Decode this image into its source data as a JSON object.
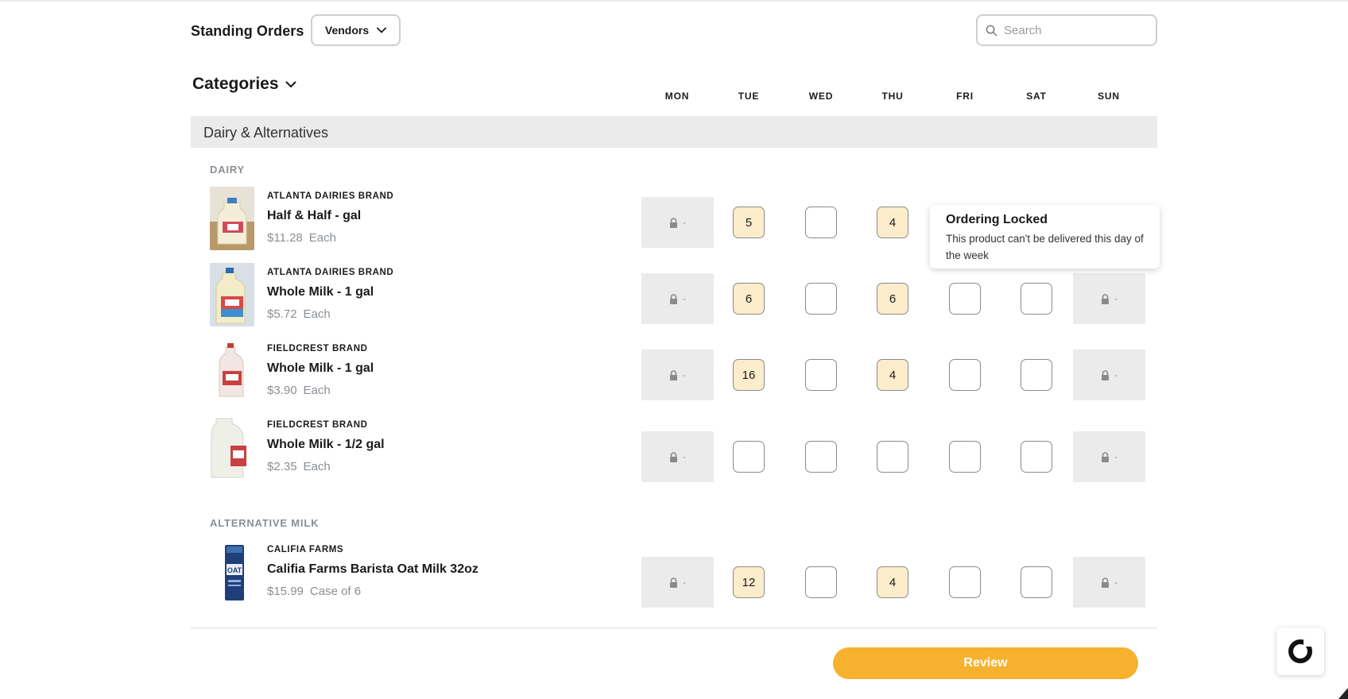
{
  "header": {
    "title": "Standing Orders",
    "vendors_label": "Vendors",
    "search_placeholder": "Search"
  },
  "categories_label": "Categories",
  "days": [
    "MON",
    "TUE",
    "WED",
    "THU",
    "FRI",
    "SAT",
    "SUN"
  ],
  "group_title": "Dairy & Alternatives",
  "sections": {
    "dairy": "DAIRY",
    "alt": "ALTERNATIVE MILK"
  },
  "products": [
    {
      "brand": "ATLANTA DAIRIES BRAND",
      "name": "Half & Half - gal",
      "price": "$11.28",
      "unit": "Each",
      "days": [
        {
          "locked": true,
          "value": "-"
        },
        {
          "locked": false,
          "value": "5"
        },
        {
          "locked": false,
          "value": ""
        },
        {
          "locked": false,
          "value": "4"
        },
        {
          "hidden": true
        },
        {
          "hidden": true
        },
        {
          "hidden": true
        }
      ]
    },
    {
      "brand": "ATLANTA DAIRIES BRAND",
      "name": "Whole Milk - 1 gal",
      "price": "$5.72",
      "unit": "Each",
      "days": [
        {
          "locked": true,
          "value": "-"
        },
        {
          "locked": false,
          "value": "6"
        },
        {
          "locked": false,
          "value": ""
        },
        {
          "locked": false,
          "value": "6"
        },
        {
          "locked": false,
          "value": ""
        },
        {
          "locked": false,
          "value": ""
        },
        {
          "locked": true,
          "value": "-"
        }
      ]
    },
    {
      "brand": "FIELDCREST BRAND",
      "name": "Whole Milk - 1 gal",
      "price": "$3.90",
      "unit": "Each",
      "days": [
        {
          "locked": true,
          "value": "-"
        },
        {
          "locked": false,
          "value": "16"
        },
        {
          "locked": false,
          "value": ""
        },
        {
          "locked": false,
          "value": "4"
        },
        {
          "locked": false,
          "value": ""
        },
        {
          "locked": false,
          "value": ""
        },
        {
          "locked": true,
          "value": "-"
        }
      ]
    },
    {
      "brand": "FIELDCREST BRAND",
      "name": "Whole Milk - 1/2 gal",
      "price": "$2.35",
      "unit": "Each",
      "days": [
        {
          "locked": true,
          "value": "-"
        },
        {
          "locked": false,
          "value": ""
        },
        {
          "locked": false,
          "value": ""
        },
        {
          "locked": false,
          "value": ""
        },
        {
          "locked": false,
          "value": ""
        },
        {
          "locked": false,
          "value": ""
        },
        {
          "locked": true,
          "value": "-"
        }
      ]
    },
    {
      "brand": "CALIFIA FARMS",
      "name": "Califia Farms Barista Oat Milk 32oz",
      "price": "$15.99",
      "unit": "Case of 6",
      "days": [
        {
          "locked": true,
          "value": "-"
        },
        {
          "locked": false,
          "value": "12"
        },
        {
          "locked": false,
          "value": ""
        },
        {
          "locked": false,
          "value": "4"
        },
        {
          "locked": false,
          "value": ""
        },
        {
          "locked": false,
          "value": ""
        },
        {
          "locked": true,
          "value": "-"
        }
      ]
    }
  ],
  "tooltip": {
    "title": "Ordering Locked",
    "body": "This product can't be delivered this day of the week"
  },
  "review_label": "Review",
  "colors": {
    "accent": "#f6b12f",
    "filled_cell": "#fbeccb",
    "locked_cell": "#ebebeb",
    "group_band": "#ebebeb"
  }
}
